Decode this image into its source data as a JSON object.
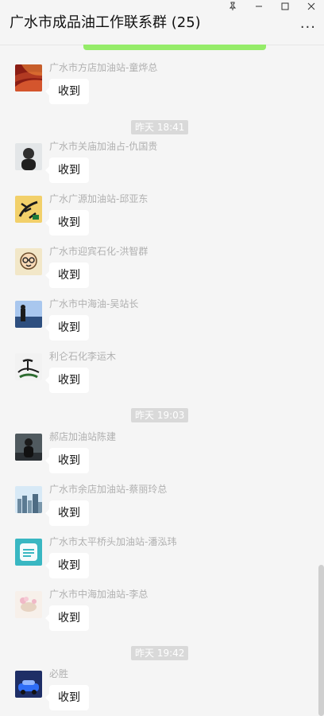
{
  "header": {
    "title": "广水市成品油工作联系群 (25)",
    "controls": {
      "pin": "⟂",
      "min": "–",
      "max": "□",
      "close": "✕"
    },
    "more": "···"
  },
  "chat": {
    "items": [
      {
        "type": "message",
        "sender": "广水市方店加油站-童烨总",
        "text": "收到",
        "avatar": "avatar-red-abstract"
      },
      {
        "type": "time",
        "text": "昨天 18:41"
      },
      {
        "type": "message",
        "sender": "广水市关庙加油占-仇国贵",
        "text": "收到",
        "avatar": "avatar-man-portrait"
      },
      {
        "type": "message",
        "sender": "广水广源加油站-邱亚东",
        "text": "收到",
        "avatar": "avatar-calligraphy"
      },
      {
        "type": "message",
        "sender": "广水市迎宾石化-洪智群",
        "text": "收到",
        "avatar": "avatar-cartoon-face"
      },
      {
        "type": "message",
        "sender": "广水市中海油-吴站长",
        "text": "收到",
        "avatar": "avatar-blue-sky"
      },
      {
        "type": "message",
        "sender": "利仑石化李运木",
        "text": "收到",
        "avatar": "avatar-ink-drawing"
      },
      {
        "type": "time",
        "text": "昨天 19:03"
      },
      {
        "type": "message",
        "sender": "郝店加油站陈建",
        "text": "收到",
        "avatar": "avatar-person-dark"
      },
      {
        "type": "message",
        "sender": "广水市余店加油站-蔡丽玲总",
        "text": "收到",
        "avatar": "avatar-city-skyline"
      },
      {
        "type": "message",
        "sender": "广水市太平桥头加油站-潘泓玮",
        "text": "收到",
        "avatar": "avatar-teal-text"
      },
      {
        "type": "message",
        "sender": "广水市中海加油站-李总",
        "text": "收到",
        "avatar": "avatar-cup-flowers"
      },
      {
        "type": "time",
        "text": "昨天 19:42"
      },
      {
        "type": "message",
        "sender": "必胜",
        "text": "收到",
        "avatar": "avatar-car-blue"
      }
    ]
  }
}
